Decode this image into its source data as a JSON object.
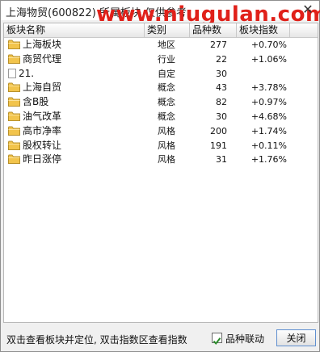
{
  "window": {
    "title": "上海物贸(600822)  所属板块 仅供参考",
    "watermark": "www.niugulan.com",
    "close_symbol": "✕"
  },
  "table": {
    "columns": [
      "板块名称",
      "类别",
      "品种数",
      "板块指数"
    ],
    "rows": [
      {
        "icon": "folder-icon",
        "name": "上海板块",
        "type": "地区",
        "count": "277",
        "index": "+0.70%"
      },
      {
        "icon": "folder-icon",
        "name": "商贸代理",
        "type": "行业",
        "count": "22",
        "index": "+1.06%"
      },
      {
        "icon": "blank-icon",
        "name": "21.",
        "type": "自定",
        "count": "30",
        "index": ""
      },
      {
        "icon": "folder-icon",
        "name": "上海自贸",
        "type": "概念",
        "count": "43",
        "index": "+3.78%"
      },
      {
        "icon": "folder-icon",
        "name": "含B股",
        "type": "概念",
        "count": "82",
        "index": "+0.97%"
      },
      {
        "icon": "folder-icon",
        "name": "油气改革",
        "type": "概念",
        "count": "30",
        "index": "+4.68%"
      },
      {
        "icon": "folder-icon",
        "name": "高市净率",
        "type": "风格",
        "count": "200",
        "index": "+1.74%"
      },
      {
        "icon": "folder-icon",
        "name": "股权转让",
        "type": "风格",
        "count": "191",
        "index": "+0.11%"
      },
      {
        "icon": "folder-icon",
        "name": "昨日涨停",
        "type": "风格",
        "count": "31",
        "index": "+1.76%"
      }
    ]
  },
  "footer": {
    "hint": "双击查看板块并定位, 双击指数区查看指数",
    "checkbox_label": "品种联动",
    "checkbox_checked": true,
    "close_label": "关闭"
  },
  "colors": {
    "watermark": "#e0211a",
    "folder": "#f2c44c",
    "checkmark": "#2a8a2a"
  }
}
